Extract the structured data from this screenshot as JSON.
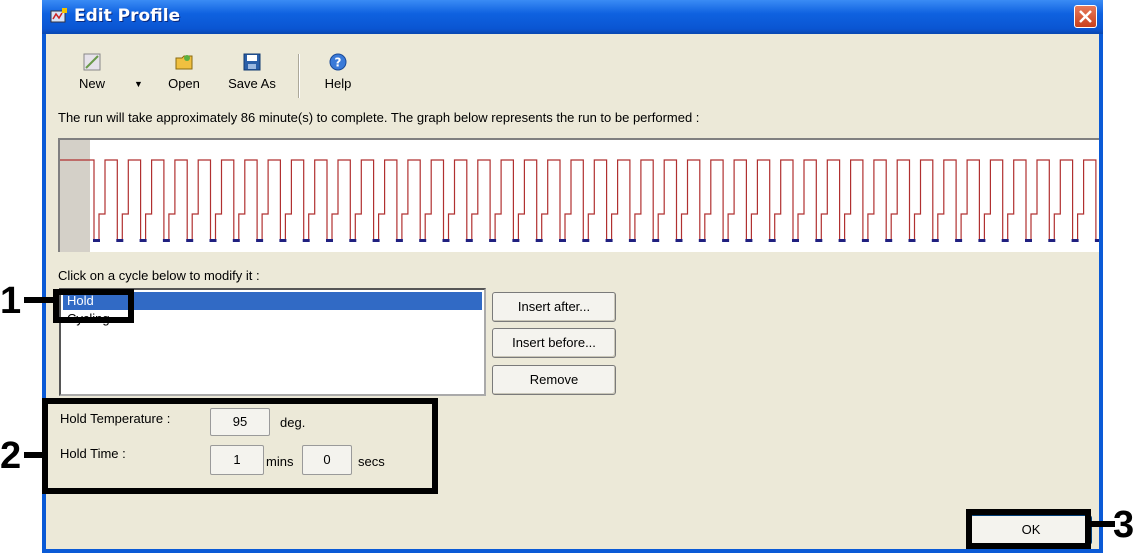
{
  "window": {
    "title": "Edit Profile",
    "icons": {
      "title": "edit-profile-icon",
      "close": "close-icon"
    }
  },
  "toolbar": {
    "new_label": "New",
    "open_label": "Open",
    "save_as_label": "Save As",
    "help_label": "Help"
  },
  "run_info": "The run will take approximately 86 minute(s) to complete. The graph below represents the run to be performed :",
  "cycle_prompt": "Click on a cycle below to modify it :",
  "cycles": [
    "Hold",
    "Cycling"
  ],
  "selected_cycle": "Hold",
  "cycle_buttons": {
    "insert_after": "Insert after...",
    "insert_before": "Insert before...",
    "remove": "Remove"
  },
  "hold": {
    "temperature_label": "Hold Temperature :",
    "temperature_value": "95",
    "temperature_unit": "deg.",
    "time_label": "Hold Time :",
    "time_mins_value": "1",
    "time_mins_unit": "mins",
    "time_secs_value": "0",
    "time_secs_unit": "secs"
  },
  "ok_label": "OK",
  "annotations": [
    "1",
    "2",
    "3"
  ],
  "colors": {
    "graph_line": "#b03030",
    "graph_marker": "#202080",
    "selection": "#316ac5",
    "titlebar": "#0a55d2"
  }
}
